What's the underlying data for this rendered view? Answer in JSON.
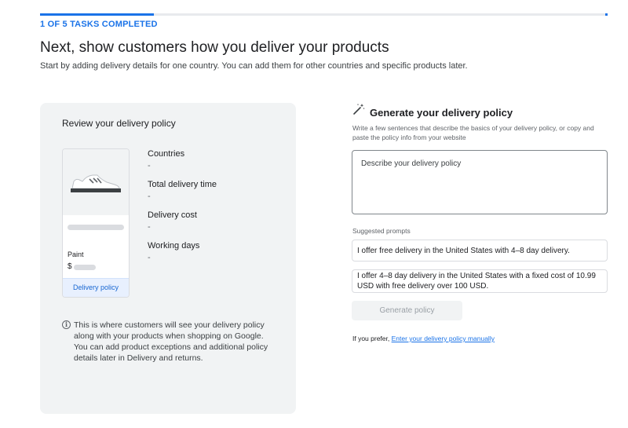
{
  "progress": {
    "label": "1 OF 5 TASKS COMPLETED",
    "completed": 1,
    "total": 5,
    "fraction": 0.2,
    "color": "#1a73e8"
  },
  "header": {
    "title": "Next, show customers how you deliver your products",
    "subtitle": "Start by adding delivery details for one country. You can add them for other countries and specific products later."
  },
  "review": {
    "title": "Review your delivery policy",
    "product": {
      "image_icon": "sneaker-icon",
      "name": "Paint",
      "currency": "$",
      "tag": "Delivery policy"
    },
    "details": [
      {
        "label": "Countries",
        "value": "-"
      },
      {
        "label": "Total delivery time",
        "value": "-"
      },
      {
        "label": "Delivery cost",
        "value": "-"
      },
      {
        "label": "Working days",
        "value": "-"
      }
    ],
    "info_icon": "info-icon",
    "info_text": "This is where customers will see your delivery policy along with your products when shopping on Google. You can add product exceptions and additional policy details later in Delivery and returns."
  },
  "generate": {
    "icon": "magic-wand-icon",
    "title": "Generate your delivery policy",
    "description": "Write a few sentences that describe the basics of your delivery policy, or copy and paste the policy info from your website",
    "input_placeholder": "Describe your delivery policy",
    "input_value": "",
    "prompts_label": "Suggested prompts",
    "prompts": [
      "I offer free delivery in the United States with 4–8 day delivery.",
      "I offer 4–8 day delivery in the United States with a fixed cost of 10.99 USD with free delivery over 100 USD."
    ],
    "button_label": "Generate policy",
    "manual_prefix": "If you prefer,",
    "manual_link": "Enter your delivery policy manually"
  }
}
